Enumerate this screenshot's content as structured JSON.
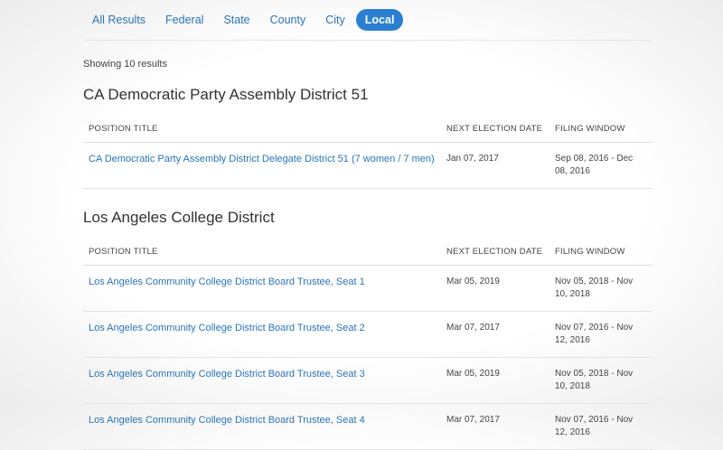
{
  "filters": {
    "tabs": [
      "All Results",
      "Federal",
      "State",
      "County",
      "City",
      "Local"
    ],
    "active_tab": "Local"
  },
  "results": {
    "summary": "Showing 10 results"
  },
  "table_headers": {
    "position_title": "POSITION TITLE",
    "next_election_date": "NEXT ELECTION DATE",
    "filing_window": "FILING WINDOW"
  },
  "groups": [
    {
      "title": "CA Democratic Party Assembly District 51",
      "rows": [
        {
          "position": "CA Democratic Party Assembly District Delegate District 51 (7 women / 7 men)",
          "election_date": "Jan 07, 2017",
          "filing_window": "Sep 08, 2016 - Dec 08, 2016"
        }
      ]
    },
    {
      "title": "Los Angeles College District",
      "rows": [
        {
          "position": "Los Angeles Community College District Board Trustee, Seat 1",
          "election_date": "Mar 05, 2019",
          "filing_window": "Nov 05, 2018 - Nov 10, 2018"
        },
        {
          "position": "Los Angeles Community College District Board Trustee, Seat 2",
          "election_date": "Mar 07, 2017",
          "filing_window": "Nov 07, 2016 - Nov 12, 2016"
        },
        {
          "position": "Los Angeles Community College District Board Trustee, Seat 3",
          "election_date": "Mar 05, 2019",
          "filing_window": "Nov 05, 2018 - Nov 10, 2018"
        },
        {
          "position": "Los Angeles Community College District Board Trustee, Seat 4",
          "election_date": "Mar 07, 2017",
          "filing_window": "Nov 07, 2016 - Nov 12, 2016"
        }
      ]
    }
  ]
}
